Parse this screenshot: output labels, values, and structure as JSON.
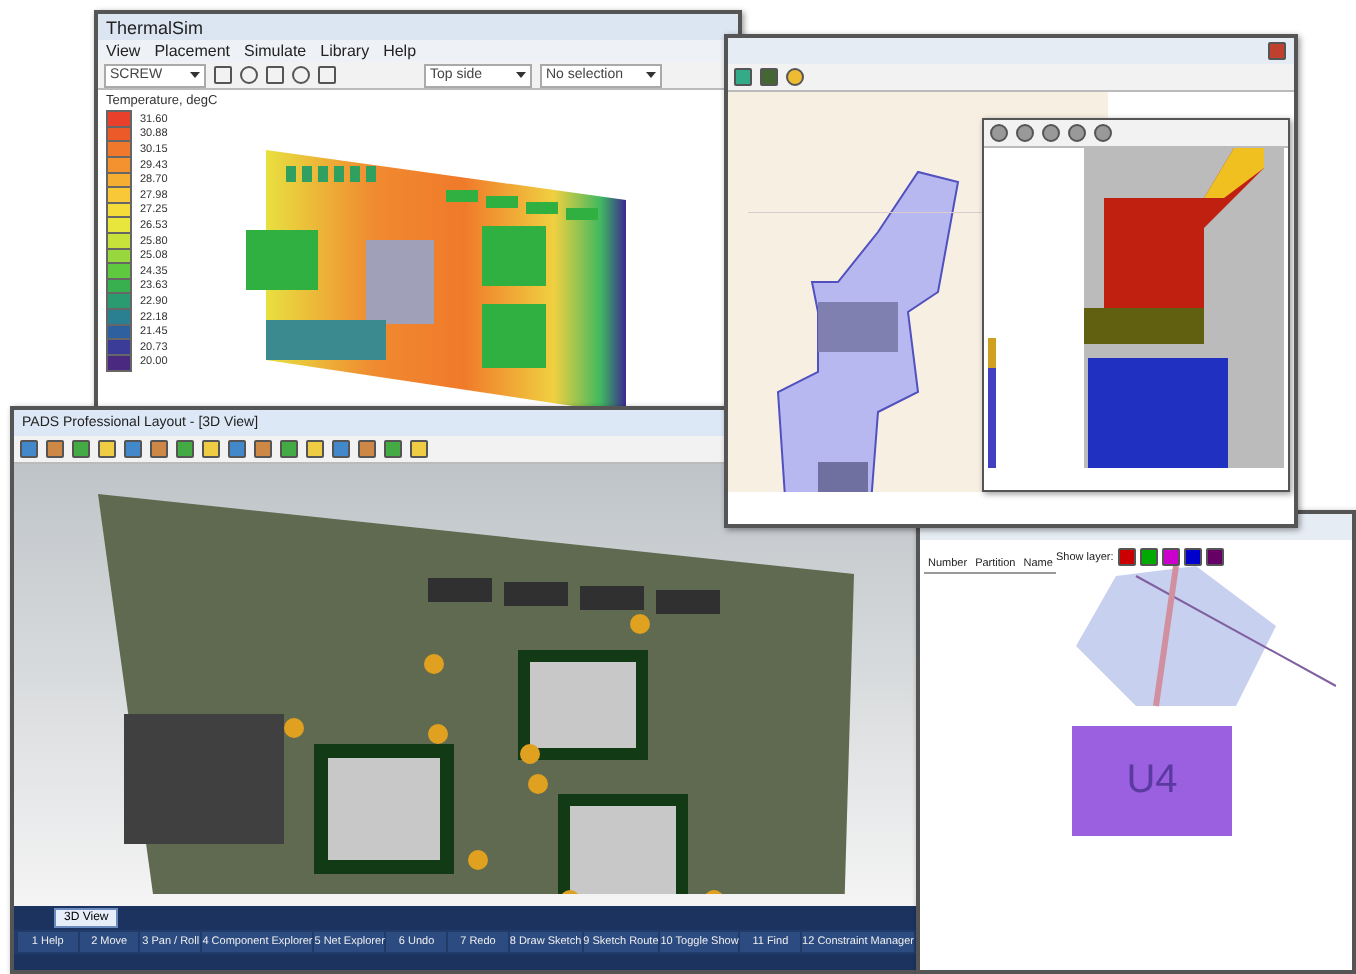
{
  "thermal_window": {
    "title": "ThermalSim",
    "menu": [
      "View",
      "Placement",
      "Simulate",
      "Library",
      "Help"
    ],
    "part_dropdown": "SCREW",
    "side_dropdown": "Top side",
    "selection_dropdown": "No selection",
    "legend": {
      "title": "Temperature, degC",
      "entries": [
        {
          "value": "31.60",
          "color": "#e8402a"
        },
        {
          "value": "30.88",
          "color": "#ec5a2a"
        },
        {
          "value": "30.15",
          "color": "#f0782c"
        },
        {
          "value": "29.43",
          "color": "#f3922e"
        },
        {
          "value": "28.70",
          "color": "#f6ae32"
        },
        {
          "value": "27.98",
          "color": "#f8c838"
        },
        {
          "value": "27.25",
          "color": "#f6dc3a"
        },
        {
          "value": "26.53",
          "color": "#e8e63c"
        },
        {
          "value": "25.80",
          "color": "#c8e23c"
        },
        {
          "value": "25.08",
          "color": "#98d83c"
        },
        {
          "value": "24.35",
          "color": "#5ec83e"
        },
        {
          "value": "23.63",
          "color": "#38b050"
        },
        {
          "value": "22.90",
          "color": "#2a9a70"
        },
        {
          "value": "22.18",
          "color": "#2a8090"
        },
        {
          "value": "21.45",
          "color": "#2e60a0"
        },
        {
          "value": "20.73",
          "color": "#3a3c98"
        },
        {
          "value": "20.00",
          "color": "#4a2a80"
        }
      ]
    }
  },
  "layout_window": {
    "title": "PADS Professional Layout - [3D View]",
    "tabs": [
      {
        "label": "3D View",
        "selected": true
      }
    ],
    "function_keys": [
      "1 Help",
      "2 Move",
      "3 Pan / Roll",
      "4 Component Explorer",
      "5 Net Explorer",
      "6 Undo",
      "7 Redo",
      "8 Draw Sketch",
      "9 Sketch Route",
      "10 Toggle Show",
      "11 Find",
      "12 Constraint Manager"
    ]
  },
  "router_window": {
    "columns": [
      "Number",
      "Partition",
      "Name"
    ],
    "layers_label": "Show layer:",
    "board_label": "U4"
  }
}
